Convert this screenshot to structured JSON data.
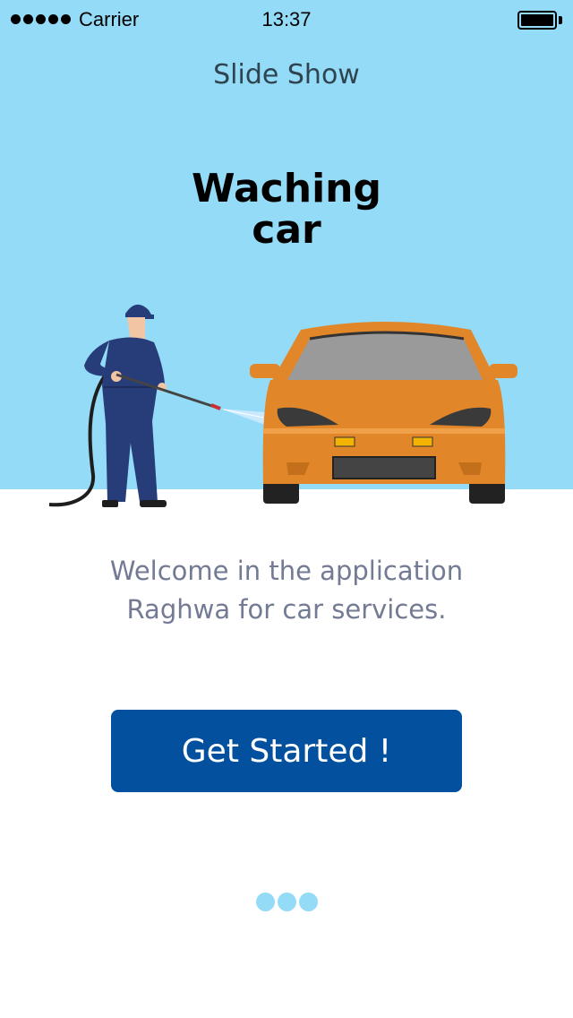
{
  "status_bar": {
    "carrier": "Carrier",
    "time": "13:37"
  },
  "nav": {
    "title": "Slide Show"
  },
  "hero": {
    "headline_line1": "Waching",
    "headline_line2": "car"
  },
  "welcome": {
    "line1": "Welcome in the application",
    "line2": "Raghwa for car services."
  },
  "cta": {
    "label": "Get Started !"
  },
  "pagination": {
    "count": 3,
    "active_index": 0
  },
  "colors": {
    "sky": "#93dbf6",
    "button": "#03519e",
    "car": "#e2862a",
    "text_muted": "#737a93"
  }
}
